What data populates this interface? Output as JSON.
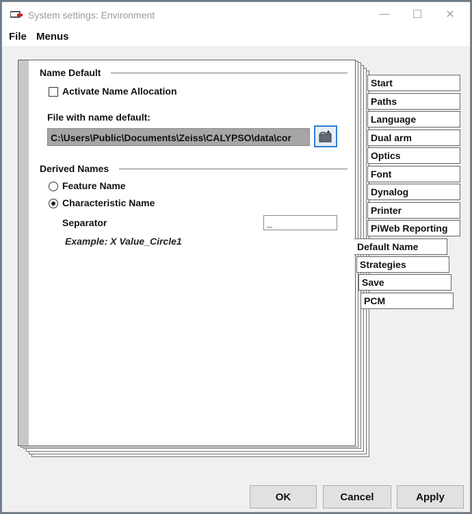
{
  "window": {
    "title": "System settings: Environment",
    "minimize": "—",
    "maximize": "☐",
    "close": "✕"
  },
  "menu": [
    "File",
    "Menus"
  ],
  "name_default": {
    "group_title": "Name Default",
    "activate_label": "Activate Name Allocation",
    "activate_checked": false,
    "file_label": "File with name default:",
    "file_path": "C:\\Users\\Public\\Documents\\Zeiss\\CALYPSO\\data\\cor"
  },
  "derived_names": {
    "group_title": "Derived Names",
    "options": [
      "Feature Name",
      "Characteristic Name"
    ],
    "selected": "Characteristic Name",
    "separator_label": "Separator",
    "separator_value": "_",
    "example": "Example: X Value_Circle1"
  },
  "tabs": [
    "Start",
    "Paths",
    "Language",
    "Dual arm",
    "Optics",
    "Font",
    "Dynalog",
    "Printer",
    "PiWeb Reporting",
    "Default Name",
    "Strategies",
    "Save",
    "PCM"
  ],
  "active_tab": "Default Name",
  "buttons": {
    "ok": "OK",
    "cancel": "Cancel",
    "apply": "Apply"
  }
}
